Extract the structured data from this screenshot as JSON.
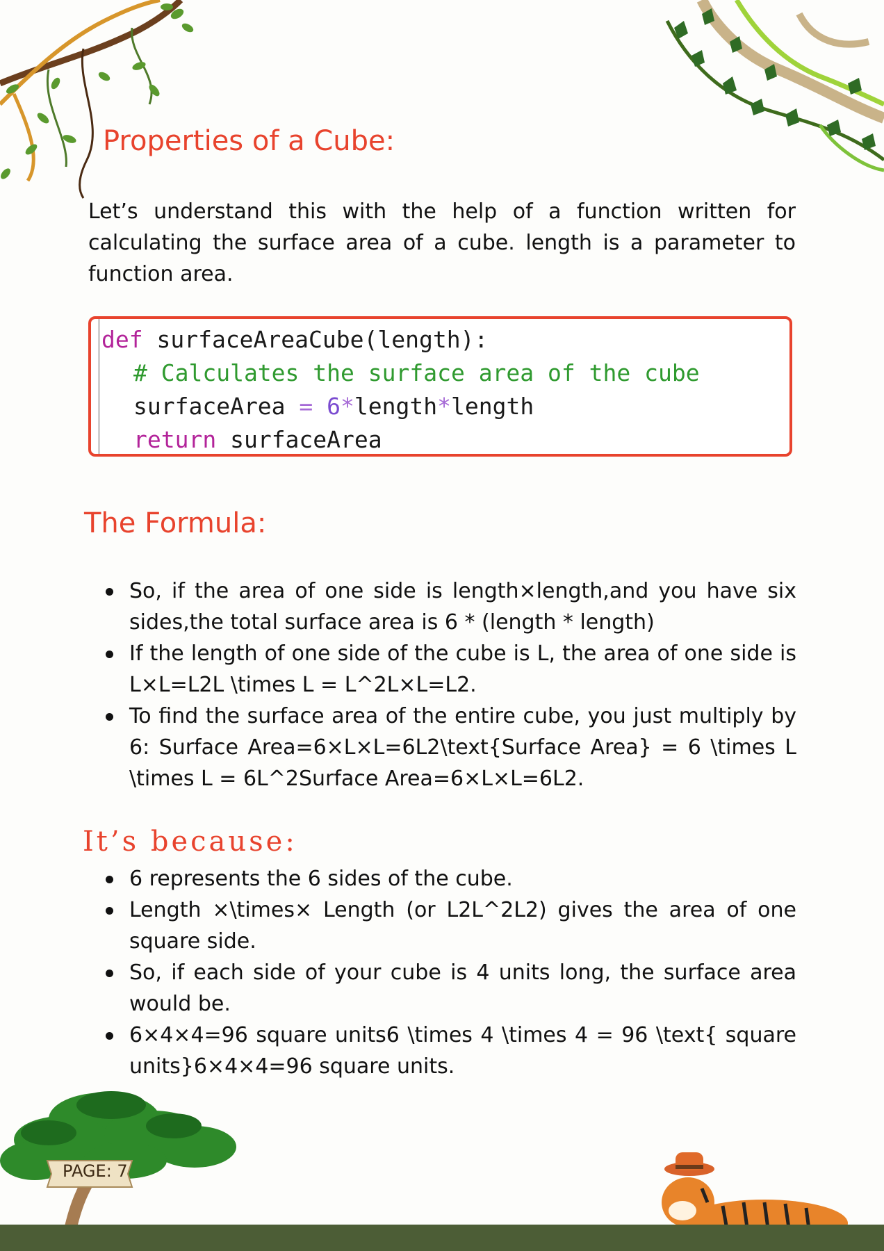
{
  "headings": {
    "properties": "Properties of a Cube:",
    "formula": "The Formula:",
    "because": "It’s because:"
  },
  "intro": "Let’s understand this with the help of a function written for calculating the surface area of a cube. length is a parameter to function area.",
  "code": {
    "line1_kw": "def",
    "line1_rest": " surfaceAreaCube(length):",
    "line2_comment": "# Calculates the surface area of the cube",
    "line3_var": "surfaceArea ",
    "line3_eq": "=",
    "line3_num": " 6",
    "line3_star1": "*",
    "line3_len1": "length",
    "line3_star2": "*",
    "line3_len2": "length",
    "line4_kw": "return",
    "line4_rest": " surfaceArea"
  },
  "formula_items": [
    "So, if the area of one side is length×length,and you have six sides,the total surface area is 6 * (length * length)",
    "If the length of one side of the cube is L, the area of one side is L×L=L2L \\times L = L^2L×L=L2.",
    "To find the surface area of the entire cube, you just multiply by 6: Surface Area=6×L×L=6L2\\text{Surface Area} = 6 \\times L \\times L = 6L^2Surface Area=6×L×L=6L2."
  ],
  "because_items": [
    "6 represents the 6 sides of the cube.",
    "Length ×\\times× Length (or L2L^2L2) gives the area of one square side.",
    "So, if each side of your cube is 4 units long, the surface area would be.",
    "6×4×4=96 square units6 \\times 4 \\times 4 = 96 \\text{ square units}6×4×4=96 square units."
  ],
  "page_label": "PAGE: 7",
  "colors": {
    "accent": "#e8432d",
    "ground": "#4c5d36"
  }
}
